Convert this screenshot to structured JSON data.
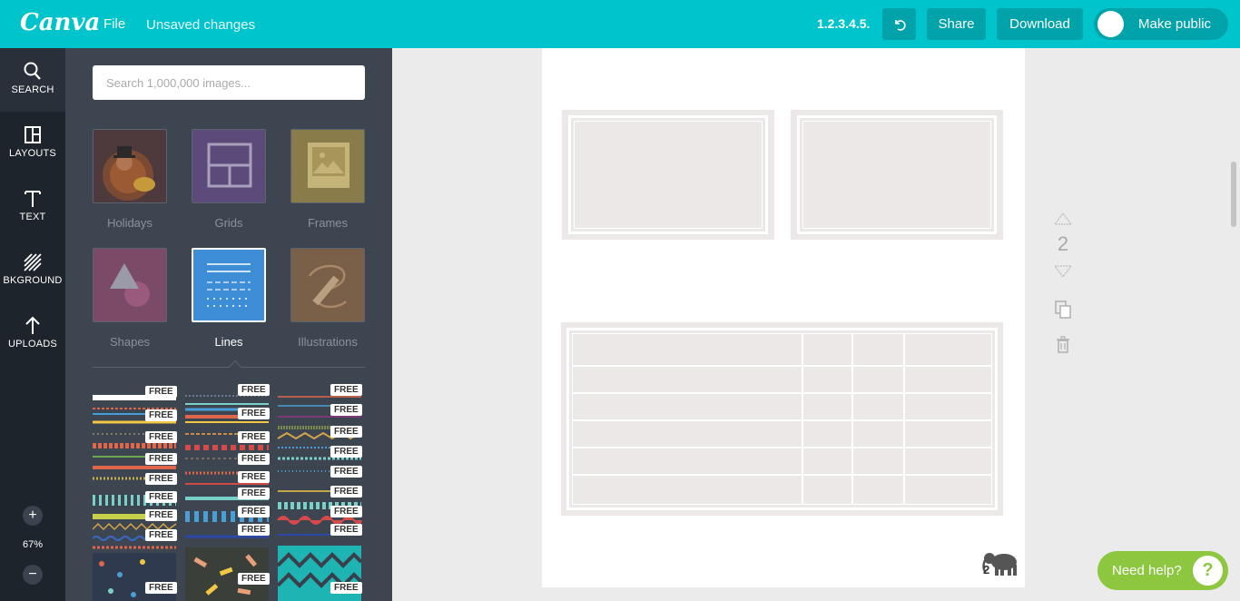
{
  "header": {
    "logo": "Canva",
    "file_label": "File",
    "unsaved_label": "Unsaved changes",
    "doc_name": "1.2.3.4.5.",
    "share_label": "Share",
    "download_label": "Download",
    "public_label": "Make public",
    "accent_color": "#00c4cc"
  },
  "rail": {
    "items": [
      {
        "label": "SEARCH",
        "icon": "search-icon"
      },
      {
        "label": "LAYOUTS",
        "icon": "layouts-icon"
      },
      {
        "label": "TEXT",
        "icon": "text-icon"
      },
      {
        "label": "BKGROUND",
        "icon": "background-icon"
      },
      {
        "label": "UPLOADS",
        "icon": "upload-icon"
      }
    ],
    "zoom_in": "+",
    "zoom_out": "−",
    "zoom_level": "67%"
  },
  "panel": {
    "search_placeholder": "Search 1,000,000 images...",
    "categories": [
      {
        "label": "Holidays"
      },
      {
        "label": "Grids"
      },
      {
        "label": "Frames"
      },
      {
        "label": "Shapes"
      },
      {
        "label": "Lines"
      },
      {
        "label": "Illustrations"
      }
    ],
    "selected_category": "Lines",
    "badge_label": "FREE"
  },
  "canvas": {
    "page_count": "2",
    "page_number": "2"
  },
  "help": {
    "label": "Need help?",
    "icon": "?"
  }
}
